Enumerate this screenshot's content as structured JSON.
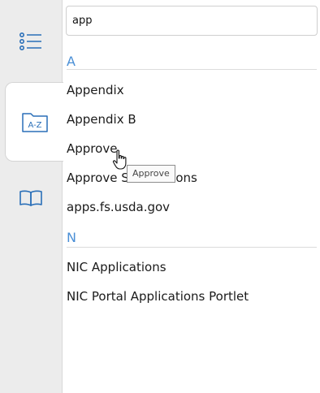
{
  "search": {
    "value": "app",
    "placeholder": ""
  },
  "rail": {
    "icons": [
      "list-icon",
      "az-folder-icon",
      "book-icon"
    ],
    "az_label": "A-Z",
    "active": "az-folder-icon"
  },
  "sections": [
    {
      "letter": "A",
      "items": [
        "Appendix",
        "Appendix B",
        "Approve",
        "Approve Submissions",
        "apps.fs.usda.gov"
      ]
    },
    {
      "letter": "N",
      "items": [
        "NIC Applications",
        "NIC Portal Applications Portlet"
      ]
    }
  ],
  "tooltip": {
    "text": "Approve"
  },
  "colors": {
    "accent": "#4a8fd6",
    "rail": "#ececec",
    "icon": "#2a6fb8"
  }
}
